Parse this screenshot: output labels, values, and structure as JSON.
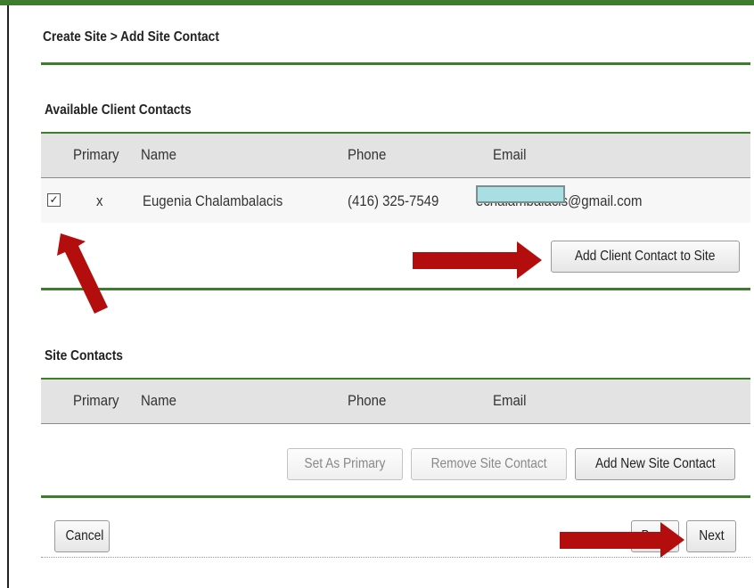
{
  "breadcrumb": "Create Site > Add Site Contact",
  "available": {
    "title": "Available Client Contacts",
    "columns": [
      "Primary",
      "Name",
      "Phone",
      "Email"
    ],
    "rows": [
      {
        "checked": true,
        "primary": "x",
        "name": "Eugenia Chalambalacis",
        "phone": "(416) 325-7549",
        "email": "echalambalacis@gmail.com"
      }
    ],
    "add_button": "Add Client Contact to Site"
  },
  "site": {
    "title": "Site Contacts",
    "columns": [
      "Primary",
      "Name",
      "Phone",
      "Email"
    ],
    "set_primary_button": "Set As Primary",
    "remove_button": "Remove Site Contact",
    "add_new_button": "Add New Site Contact"
  },
  "footer": {
    "cancel_button": "Cancel",
    "back_button": "Back",
    "next_button": "Next"
  },
  "colors": {
    "accent": "#3f7d2e",
    "annotation_arrow": "#b30d0d",
    "redaction": "#a9dfe3"
  },
  "icons": {
    "checkbox": "checkbox-checked-icon"
  }
}
